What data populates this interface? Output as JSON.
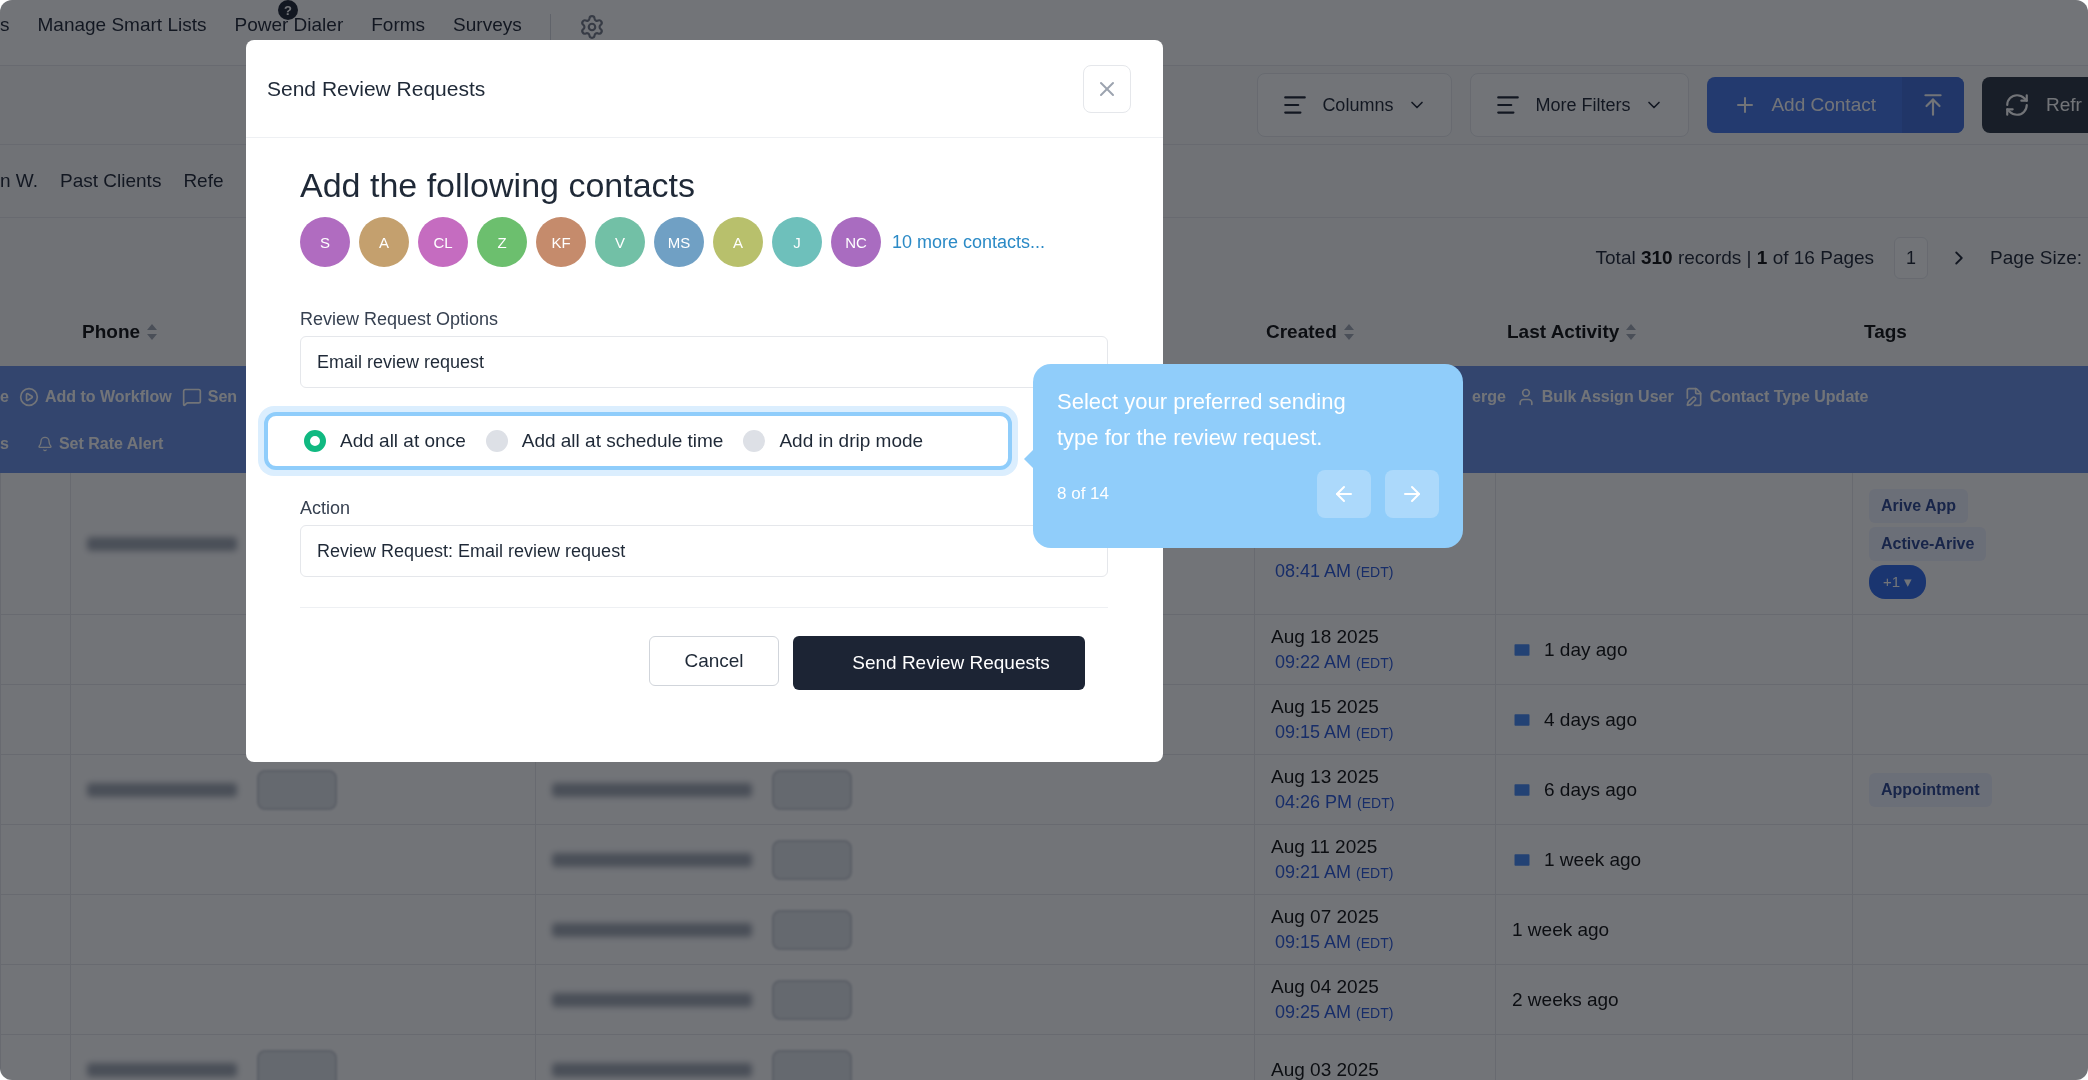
{
  "top_nav": {
    "items": [
      {
        "label": "s"
      },
      {
        "label": "Manage Smart Lists"
      },
      {
        "label": "Power Dialer",
        "badge": "?"
      },
      {
        "label": "Forms"
      },
      {
        "label": "Surveys"
      }
    ]
  },
  "toolbar": {
    "columns_button": "Columns",
    "filters_button": "More Filters",
    "add_button": "Add Contact",
    "refresh_button": "Refr"
  },
  "smart_lists": [
    "n W.",
    "Past Clients",
    "Refe"
  ],
  "pagination": {
    "summary": "Total **310** records | **1** of 16 Pages",
    "page": "1",
    "page_size_label": "Page Size:"
  },
  "table": {
    "columns": [
      {
        "label": "Phone",
        "sortable": true
      },
      {
        "label": "Created",
        "sortable": true
      },
      {
        "label": "Last Activity",
        "sortable": true
      },
      {
        "label": "Tags",
        "sortable": false
      }
    ],
    "bulk_actions": {
      "row_1_left": [
        "e",
        "Add to Workflow",
        "Sen"
      ],
      "row_1_right": [
        "erge",
        "Bulk Assign User",
        "Contact Type Update"
      ],
      "row_2": [
        "s",
        "Set Rate Alert"
      ]
    },
    "rows": [
      {
        "phone_redacted": true,
        "created_time": "08:41 AM",
        "timezone": "(EDT)",
        "tags": [
          "Arive App",
          "Active-Arive"
        ],
        "more_tags": "+1 ▾"
      },
      {
        "created_date": "Aug 18 2025",
        "created_time": "09:22 AM",
        "timezone": "(EDT)",
        "last_activity": "1 day ago",
        "activity_email": true
      },
      {
        "created_date": "Aug 15 2025",
        "created_time": "09:15 AM",
        "timezone": "(EDT)",
        "last_activity": "4 days ago",
        "activity_email": true
      },
      {
        "phone_redacted": true,
        "call_chip": true,
        "email_redacted": true,
        "created_date": "Aug 13 2025",
        "created_time": "04:26 PM",
        "timezone": "(EDT)",
        "last_activity": "6 days ago",
        "activity_email": true,
        "tags": [
          "Appointment"
        ]
      },
      {
        "email_redacted": true,
        "created_date": "Aug 11 2025",
        "created_time": "09:21 AM",
        "timezone": "(EDT)",
        "last_activity": "1 week ago",
        "activity_email": true
      },
      {
        "email_redacted": true,
        "created_date": "Aug 07 2025",
        "created_time": "09:15 AM",
        "timezone": "(EDT)",
        "last_activity": "1 week ago",
        "activity_email": false
      },
      {
        "email_redacted": true,
        "created_date": "Aug 04 2025",
        "created_time": "09:25 AM",
        "timezone": "(EDT)",
        "last_activity": "2 weeks ago",
        "activity_email": false
      },
      {
        "phone_redacted": true,
        "call_chip": true,
        "email_redacted": true,
        "created_date": "Aug 03 2025"
      }
    ]
  },
  "modal": {
    "title": "Send Review Requests",
    "heading": "Add the following contacts",
    "contacts": [
      {
        "initials": "S",
        "color": "#b06cc0"
      },
      {
        "initials": "A",
        "color": "#c4a06e"
      },
      {
        "initials": "CL",
        "color": "#c56cc0"
      },
      {
        "initials": "Z",
        "color": "#6cbf6e"
      },
      {
        "initials": "KF",
        "color": "#c58b6c"
      },
      {
        "initials": "V",
        "color": "#72c0a6"
      },
      {
        "initials": "MS",
        "color": "#70a0c4"
      },
      {
        "initials": "A",
        "color": "#b8c06c"
      },
      {
        "initials": "J",
        "color": "#6ec0bb"
      },
      {
        "initials": "NC",
        "color": "#a96cc0"
      }
    ],
    "more_contacts": "10 more contacts...",
    "options_label": "Review Request Options",
    "options_value": "Email review request",
    "modes": [
      {
        "label": "Add all at once",
        "selected": true
      },
      {
        "label": "Add all at schedule time",
        "selected": false
      },
      {
        "label": "Add in drip mode",
        "selected": false
      }
    ],
    "action_label": "Action",
    "action_value": "Review Request: Email review request",
    "cancel": "Cancel",
    "submit": "Send Review Requests"
  },
  "tour": {
    "text": "Select your preferred sending type for the review request.",
    "step": "8 of 14"
  }
}
